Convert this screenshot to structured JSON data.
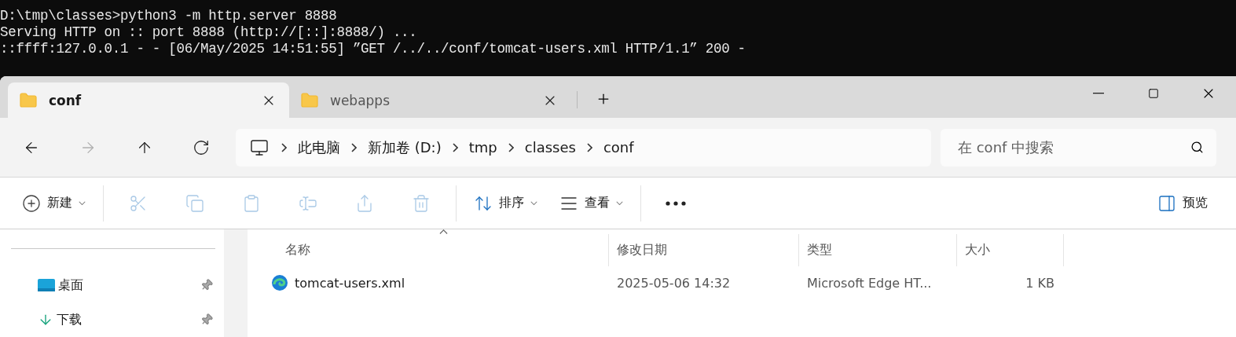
{
  "terminal": {
    "lines": [
      "D:\\tmp\\classes>python3 -m http.server 8888",
      "Serving HTTP on :: port 8888 (http://[::]:8888/) ...",
      "::ffff:127.0.0.1 - - [06/May/2025 14:51:55] ”GET /../../conf/tomcat-users.xml HTTP/1.1” 200 -"
    ]
  },
  "tabs": [
    {
      "label": "conf",
      "selected": true
    },
    {
      "label": "webapps",
      "selected": false
    }
  ],
  "nav": [
    {
      "kind": "back",
      "disabled": false
    },
    {
      "kind": "forward",
      "disabled": true
    },
    {
      "kind": "up",
      "disabled": false
    },
    {
      "kind": "refresh",
      "disabled": false
    }
  ],
  "breadcrumb": [
    "此电脑",
    "新加卷 (D:)",
    "tmp",
    "classes",
    "conf"
  ],
  "search": {
    "placeholder": "在 conf 中搜索"
  },
  "toolbar": [
    {
      "kind": "new",
      "label": "新建",
      "disabled": false
    },
    {
      "kind": "separator"
    },
    {
      "kind": "cut",
      "disabled": true
    },
    {
      "kind": "copy",
      "disabled": true
    },
    {
      "kind": "paste",
      "disabled": true
    },
    {
      "kind": "rename",
      "disabled": true
    },
    {
      "kind": "share",
      "disabled": true
    },
    {
      "kind": "delete",
      "disabled": true
    },
    {
      "kind": "separator"
    },
    {
      "kind": "sort",
      "label": "排序",
      "disabled": false
    },
    {
      "kind": "view",
      "label": "查看",
      "disabled": false
    },
    {
      "kind": "separator"
    },
    {
      "kind": "more",
      "disabled": false
    }
  ],
  "preview": {
    "label": "预览"
  },
  "sidebar": {
    "items": [
      {
        "kind": "desktop",
        "label": "桌面",
        "pinned": true
      },
      {
        "kind": "downloads",
        "label": "下载",
        "pinned": true
      }
    ]
  },
  "table": {
    "columns": [
      "名称",
      "修改日期",
      "类型",
      "大小"
    ],
    "rows": [
      {
        "name": "tomcat-users.xml",
        "modified": "2025-05-06 14:32",
        "type": "Microsoft Edge HT...",
        "size": "1 KB",
        "selected": false
      }
    ]
  }
}
